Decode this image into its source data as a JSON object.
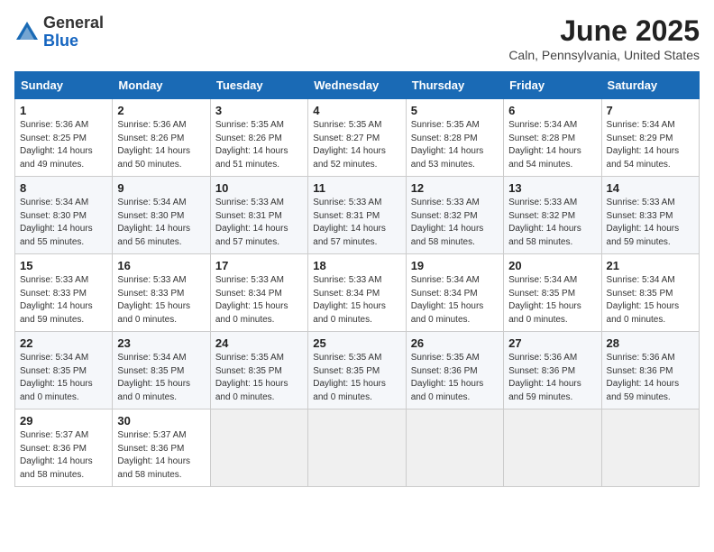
{
  "logo": {
    "general": "General",
    "blue": "Blue"
  },
  "title": "June 2025",
  "location": "Caln, Pennsylvania, United States",
  "days_of_week": [
    "Sunday",
    "Monday",
    "Tuesday",
    "Wednesday",
    "Thursday",
    "Friday",
    "Saturday"
  ],
  "weeks": [
    [
      {
        "day": 1,
        "sunrise": "5:36 AM",
        "sunset": "8:25 PM",
        "daylight": "14 hours and 49 minutes."
      },
      {
        "day": 2,
        "sunrise": "5:36 AM",
        "sunset": "8:26 PM",
        "daylight": "14 hours and 50 minutes."
      },
      {
        "day": 3,
        "sunrise": "5:35 AM",
        "sunset": "8:26 PM",
        "daylight": "14 hours and 51 minutes."
      },
      {
        "day": 4,
        "sunrise": "5:35 AM",
        "sunset": "8:27 PM",
        "daylight": "14 hours and 52 minutes."
      },
      {
        "day": 5,
        "sunrise": "5:35 AM",
        "sunset": "8:28 PM",
        "daylight": "14 hours and 53 minutes."
      },
      {
        "day": 6,
        "sunrise": "5:34 AM",
        "sunset": "8:28 PM",
        "daylight": "14 hours and 54 minutes."
      },
      {
        "day": 7,
        "sunrise": "5:34 AM",
        "sunset": "8:29 PM",
        "daylight": "14 hours and 54 minutes."
      }
    ],
    [
      {
        "day": 8,
        "sunrise": "5:34 AM",
        "sunset": "8:30 PM",
        "daylight": "14 hours and 55 minutes."
      },
      {
        "day": 9,
        "sunrise": "5:34 AM",
        "sunset": "8:30 PM",
        "daylight": "14 hours and 56 minutes."
      },
      {
        "day": 10,
        "sunrise": "5:33 AM",
        "sunset": "8:31 PM",
        "daylight": "14 hours and 57 minutes."
      },
      {
        "day": 11,
        "sunrise": "5:33 AM",
        "sunset": "8:31 PM",
        "daylight": "14 hours and 57 minutes."
      },
      {
        "day": 12,
        "sunrise": "5:33 AM",
        "sunset": "8:32 PM",
        "daylight": "14 hours and 58 minutes."
      },
      {
        "day": 13,
        "sunrise": "5:33 AM",
        "sunset": "8:32 PM",
        "daylight": "14 hours and 58 minutes."
      },
      {
        "day": 14,
        "sunrise": "5:33 AM",
        "sunset": "8:33 PM",
        "daylight": "14 hours and 59 minutes."
      }
    ],
    [
      {
        "day": 15,
        "sunrise": "5:33 AM",
        "sunset": "8:33 PM",
        "daylight": "14 hours and 59 minutes."
      },
      {
        "day": 16,
        "sunrise": "5:33 AM",
        "sunset": "8:33 PM",
        "daylight": "15 hours and 0 minutes."
      },
      {
        "day": 17,
        "sunrise": "5:33 AM",
        "sunset": "8:34 PM",
        "daylight": "15 hours and 0 minutes."
      },
      {
        "day": 18,
        "sunrise": "5:33 AM",
        "sunset": "8:34 PM",
        "daylight": "15 hours and 0 minutes."
      },
      {
        "day": 19,
        "sunrise": "5:34 AM",
        "sunset": "8:34 PM",
        "daylight": "15 hours and 0 minutes."
      },
      {
        "day": 20,
        "sunrise": "5:34 AM",
        "sunset": "8:35 PM",
        "daylight": "15 hours and 0 minutes."
      },
      {
        "day": 21,
        "sunrise": "5:34 AM",
        "sunset": "8:35 PM",
        "daylight": "15 hours and 0 minutes."
      }
    ],
    [
      {
        "day": 22,
        "sunrise": "5:34 AM",
        "sunset": "8:35 PM",
        "daylight": "15 hours and 0 minutes."
      },
      {
        "day": 23,
        "sunrise": "5:34 AM",
        "sunset": "8:35 PM",
        "daylight": "15 hours and 0 minutes."
      },
      {
        "day": 24,
        "sunrise": "5:35 AM",
        "sunset": "8:35 PM",
        "daylight": "15 hours and 0 minutes."
      },
      {
        "day": 25,
        "sunrise": "5:35 AM",
        "sunset": "8:35 PM",
        "daylight": "15 hours and 0 minutes."
      },
      {
        "day": 26,
        "sunrise": "5:35 AM",
        "sunset": "8:36 PM",
        "daylight": "15 hours and 0 minutes."
      },
      {
        "day": 27,
        "sunrise": "5:36 AM",
        "sunset": "8:36 PM",
        "daylight": "14 hours and 59 minutes."
      },
      {
        "day": 28,
        "sunrise": "5:36 AM",
        "sunset": "8:36 PM",
        "daylight": "14 hours and 59 minutes."
      }
    ],
    [
      {
        "day": 29,
        "sunrise": "5:37 AM",
        "sunset": "8:36 PM",
        "daylight": "14 hours and 58 minutes."
      },
      {
        "day": 30,
        "sunrise": "5:37 AM",
        "sunset": "8:36 PM",
        "daylight": "14 hours and 58 minutes."
      },
      null,
      null,
      null,
      null,
      null
    ]
  ]
}
